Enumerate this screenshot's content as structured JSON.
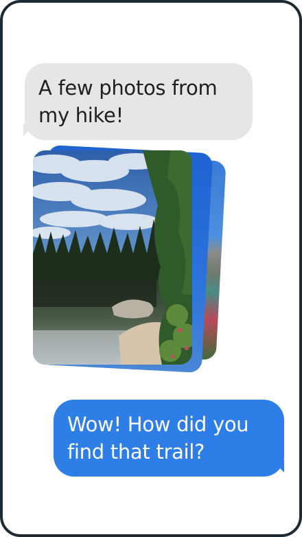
{
  "messages": {
    "incoming": {
      "text": "A few photos from my hike!"
    },
    "outgoing": {
      "text": "Wow! How did you find that trail?"
    }
  },
  "photos": {
    "count_visible": 3
  },
  "colors": {
    "incoming_bubble": "#e6e6e6",
    "outgoing_bubble": "#2e7ee8",
    "frame": "#1d2a33"
  }
}
